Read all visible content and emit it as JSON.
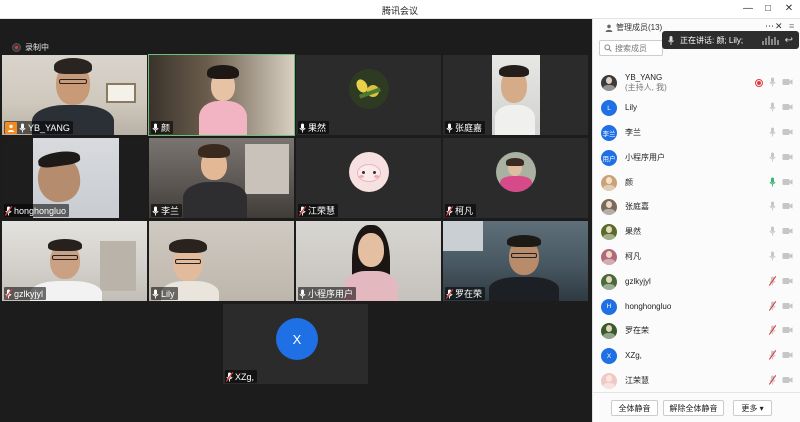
{
  "window": {
    "title": "腾讯会议",
    "controls": [
      "minimize-icon",
      "maximize-icon",
      "close-icon"
    ]
  },
  "recording": {
    "label": "录制中"
  },
  "tiles": [
    {
      "name": "YB_YANG",
      "host": true,
      "mic": "on",
      "scene": "man-glasses-room"
    },
    {
      "name": "颜",
      "host": false,
      "mic": "on",
      "active": true,
      "scene": "woman-pink"
    },
    {
      "name": "果然",
      "host": false,
      "mic": "on",
      "scene": "flower-avatar"
    },
    {
      "name": "张庭嘉",
      "host": false,
      "mic": "on",
      "scene": "man-window"
    },
    {
      "name": "honghongluo",
      "host": false,
      "mic": "muted",
      "scene": "man-close"
    },
    {
      "name": "李兰",
      "host": false,
      "mic": "on",
      "scene": "woman-kitchen"
    },
    {
      "name": "江荣慧",
      "host": false,
      "mic": "muted",
      "scene": "cartoon-avatar"
    },
    {
      "name": "柯凡",
      "host": false,
      "mic": "muted",
      "scene": "photo-avatar"
    },
    {
      "name": "gzlkyjyl",
      "host": false,
      "mic": "muted",
      "scene": "man-office"
    },
    {
      "name": "Lily",
      "host": false,
      "mic": "on",
      "scene": "woman-glasses"
    },
    {
      "name": "小程序用户",
      "host": false,
      "mic": "on",
      "scene": "young-woman"
    },
    {
      "name": "罗在荣",
      "host": false,
      "mic": "muted",
      "scene": "man-couch"
    },
    {
      "name": "XZg,",
      "host": false,
      "mic": "muted",
      "scene": "letter-avatar",
      "letter": "X"
    }
  ],
  "panel": {
    "title": "管理成员(13)",
    "search_placeholder": "搜索成员",
    "speaking_label": "正在讲话: 颜; Lily;",
    "host_role": "(主持人, 我)",
    "members": [
      {
        "name": "YB_YANG",
        "avatar": "photo",
        "avatar_color": "#3b3b3b",
        "recording": true,
        "mic": "off-gray",
        "cam": "on"
      },
      {
        "name": "Lily",
        "avatar": "letter",
        "avatar_text": "L",
        "avatar_color": "#1f6fe5",
        "mic": "off-gray",
        "cam": "on"
      },
      {
        "name": "李兰",
        "avatar": "letter",
        "avatar_text": "李兰",
        "avatar_color": "#1f6fe5",
        "mic": "off-gray",
        "cam": "on"
      },
      {
        "name": "小程序用户",
        "avatar": "letter",
        "avatar_text": "用户",
        "avatar_color": "#1f6fe5",
        "mic": "off-gray",
        "cam": "on"
      },
      {
        "name": "颜",
        "avatar": "photo",
        "avatar_color": "#c9a27a",
        "mic": "speaking",
        "cam": "on"
      },
      {
        "name": "张庭嘉",
        "avatar": "photo",
        "avatar_color": "#7a6a5a",
        "mic": "off-gray",
        "cam": "on"
      },
      {
        "name": "果然",
        "avatar": "photo",
        "avatar_color": "#5a6a2a",
        "mic": "off-gray",
        "cam": "on"
      },
      {
        "name": "柯凡",
        "avatar": "photo",
        "avatar_color": "#b06a7a",
        "mic": "off-gray",
        "cam": "on"
      },
      {
        "name": "gzlkyjyl",
        "avatar": "photo",
        "avatar_color": "#4a6a3a",
        "mic": "muted",
        "cam": "on"
      },
      {
        "name": "honghongluo",
        "avatar": "letter",
        "avatar_text": "H",
        "avatar_color": "#1f6fe5",
        "mic": "muted",
        "cam": "on"
      },
      {
        "name": "罗在荣",
        "avatar": "photo",
        "avatar_color": "#3a5a2a",
        "mic": "muted",
        "cam": "on"
      },
      {
        "name": "XZg,",
        "avatar": "letter",
        "avatar_text": "X",
        "avatar_color": "#1f6fe5",
        "mic": "muted",
        "cam": "on"
      },
      {
        "name": "江荣慧",
        "avatar": "photo",
        "avatar_color": "#f0c8c8",
        "mic": "muted",
        "cam": "on"
      }
    ],
    "footer": {
      "mute_all": "全体静音",
      "unmute_all": "解除全体静音",
      "more": "更多 ▾"
    }
  },
  "colors": {
    "accent": "#1f6fe5",
    "host_badge": "#f28a1e",
    "muted_red": "#e23b3b",
    "speaking_green": "#3cb371",
    "active_border": "#6bbf7a"
  }
}
